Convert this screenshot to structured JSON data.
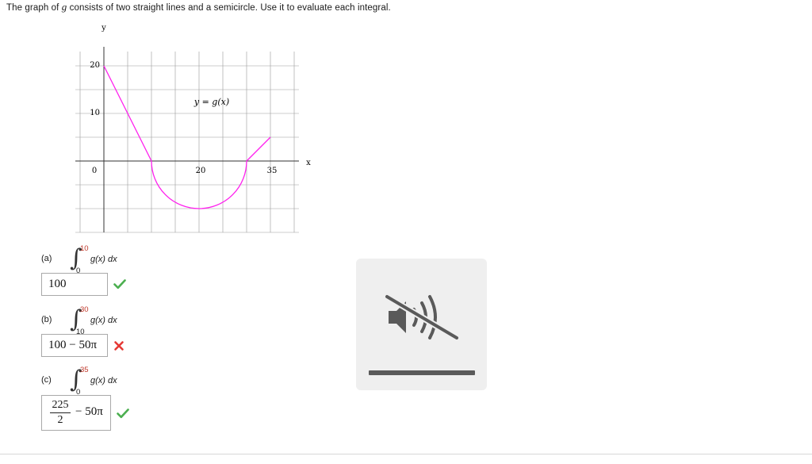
{
  "question": {
    "prefix": "The graph of ",
    "func": "g",
    "suffix": " consists of two straight lines and a semicircle. Use it to evaluate each integral."
  },
  "graph": {
    "axis_x_label": "x",
    "axis_y_label": "y",
    "x_tick_labels": [
      "0",
      "20",
      "35"
    ],
    "y_tick_labels": [
      "20",
      "10"
    ],
    "curve_label": "y = g(x)",
    "curve_color": "#ff22ee",
    "grid_color": "#999999"
  },
  "chart_data": {
    "type": "line",
    "xlabel": "x",
    "ylabel": "y",
    "xlim": [
      -5,
      42
    ],
    "ylim": [
      -15,
      23
    ],
    "x_ticks": [
      0,
      20,
      35
    ],
    "y_ticks": [
      10,
      20
    ],
    "grid": true,
    "annotation": "y = g(x)",
    "series": [
      {
        "segments": [
          {
            "kind": "line",
            "points": [
              [
                0,
                20
              ],
              [
                10,
                0
              ]
            ]
          },
          {
            "kind": "semicircle",
            "center": [
              20,
              0
            ],
            "radius": 10,
            "half": "lower"
          },
          {
            "kind": "line",
            "points": [
              [
                30,
                0
              ],
              [
                35,
                5
              ]
            ]
          }
        ]
      }
    ]
  },
  "parts": [
    {
      "label": "(a)",
      "lower": "0",
      "upper": "10",
      "integrand": "g(x) dx",
      "answer": "100",
      "status": "correct"
    },
    {
      "label": "(b)",
      "lower": "10",
      "upper": "30",
      "integrand": "g(x) dx",
      "answer": "100 − 50π",
      "status": "incorrect"
    },
    {
      "label": "(c)",
      "lower": "0",
      "upper": "35",
      "integrand": "g(x) dx",
      "answer_numerator": "225",
      "answer_denominator": "2",
      "answer_rest": "− 50π",
      "status": "correct"
    }
  ],
  "media": {
    "icon": "muted-speaker-icon",
    "volume": 1.0
  },
  "colors": {
    "correct": "#4caf50",
    "incorrect": "#e53935",
    "panel_bg": "#efefef"
  }
}
